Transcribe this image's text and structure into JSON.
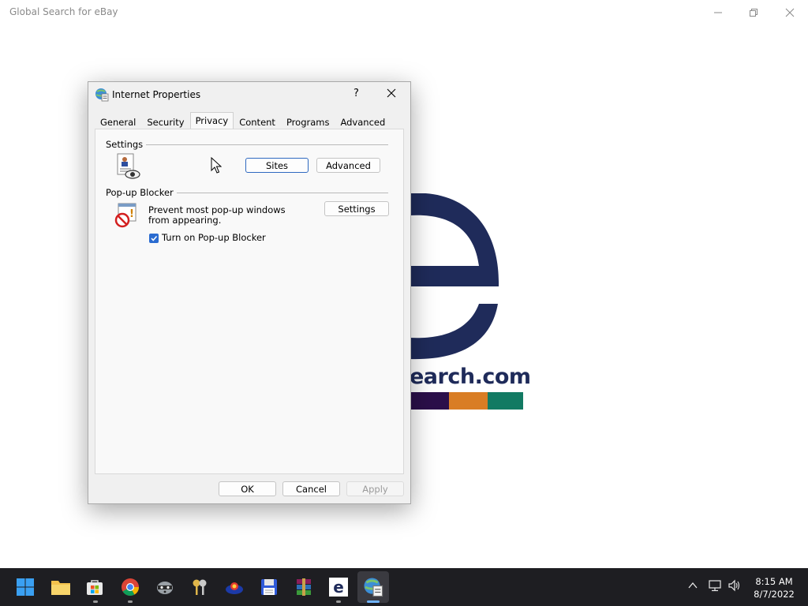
{
  "app": {
    "title": "Global Search for eBay",
    "logo_text": "earch.com",
    "bar_colors": [
      "#2b0f4a",
      "#d97d24",
      "#127a63"
    ]
  },
  "dialog": {
    "title": "Internet Properties",
    "help": "?",
    "tabs": [
      "General",
      "Security",
      "Privacy",
      "Content",
      "Programs",
      "Advanced"
    ],
    "active_tab": "Privacy",
    "settings_group": {
      "label": "Settings",
      "sites_button": "Sites",
      "advanced_button": "Advanced"
    },
    "popup_group": {
      "label": "Pop-up Blocker",
      "description": "Prevent most pop-up windows from appearing.",
      "settings_button": "Settings",
      "checkbox_label": "Turn on Pop-up Blocker",
      "checkbox_checked": true
    },
    "footer": {
      "ok": "OK",
      "cancel": "Cancel",
      "apply": "Apply"
    }
  },
  "taskbar": {
    "icons": [
      "start-icon",
      "file-explorer-icon",
      "store-icon",
      "chrome-icon",
      "raccoon-icon",
      "keys-icon",
      "app-icon",
      "save-disk-icon",
      "winrar-icon",
      "ebay-search-icon",
      "internet-properties-icon"
    ],
    "clock_time": "8:15 AM",
    "clock_date": "8/7/2022"
  }
}
